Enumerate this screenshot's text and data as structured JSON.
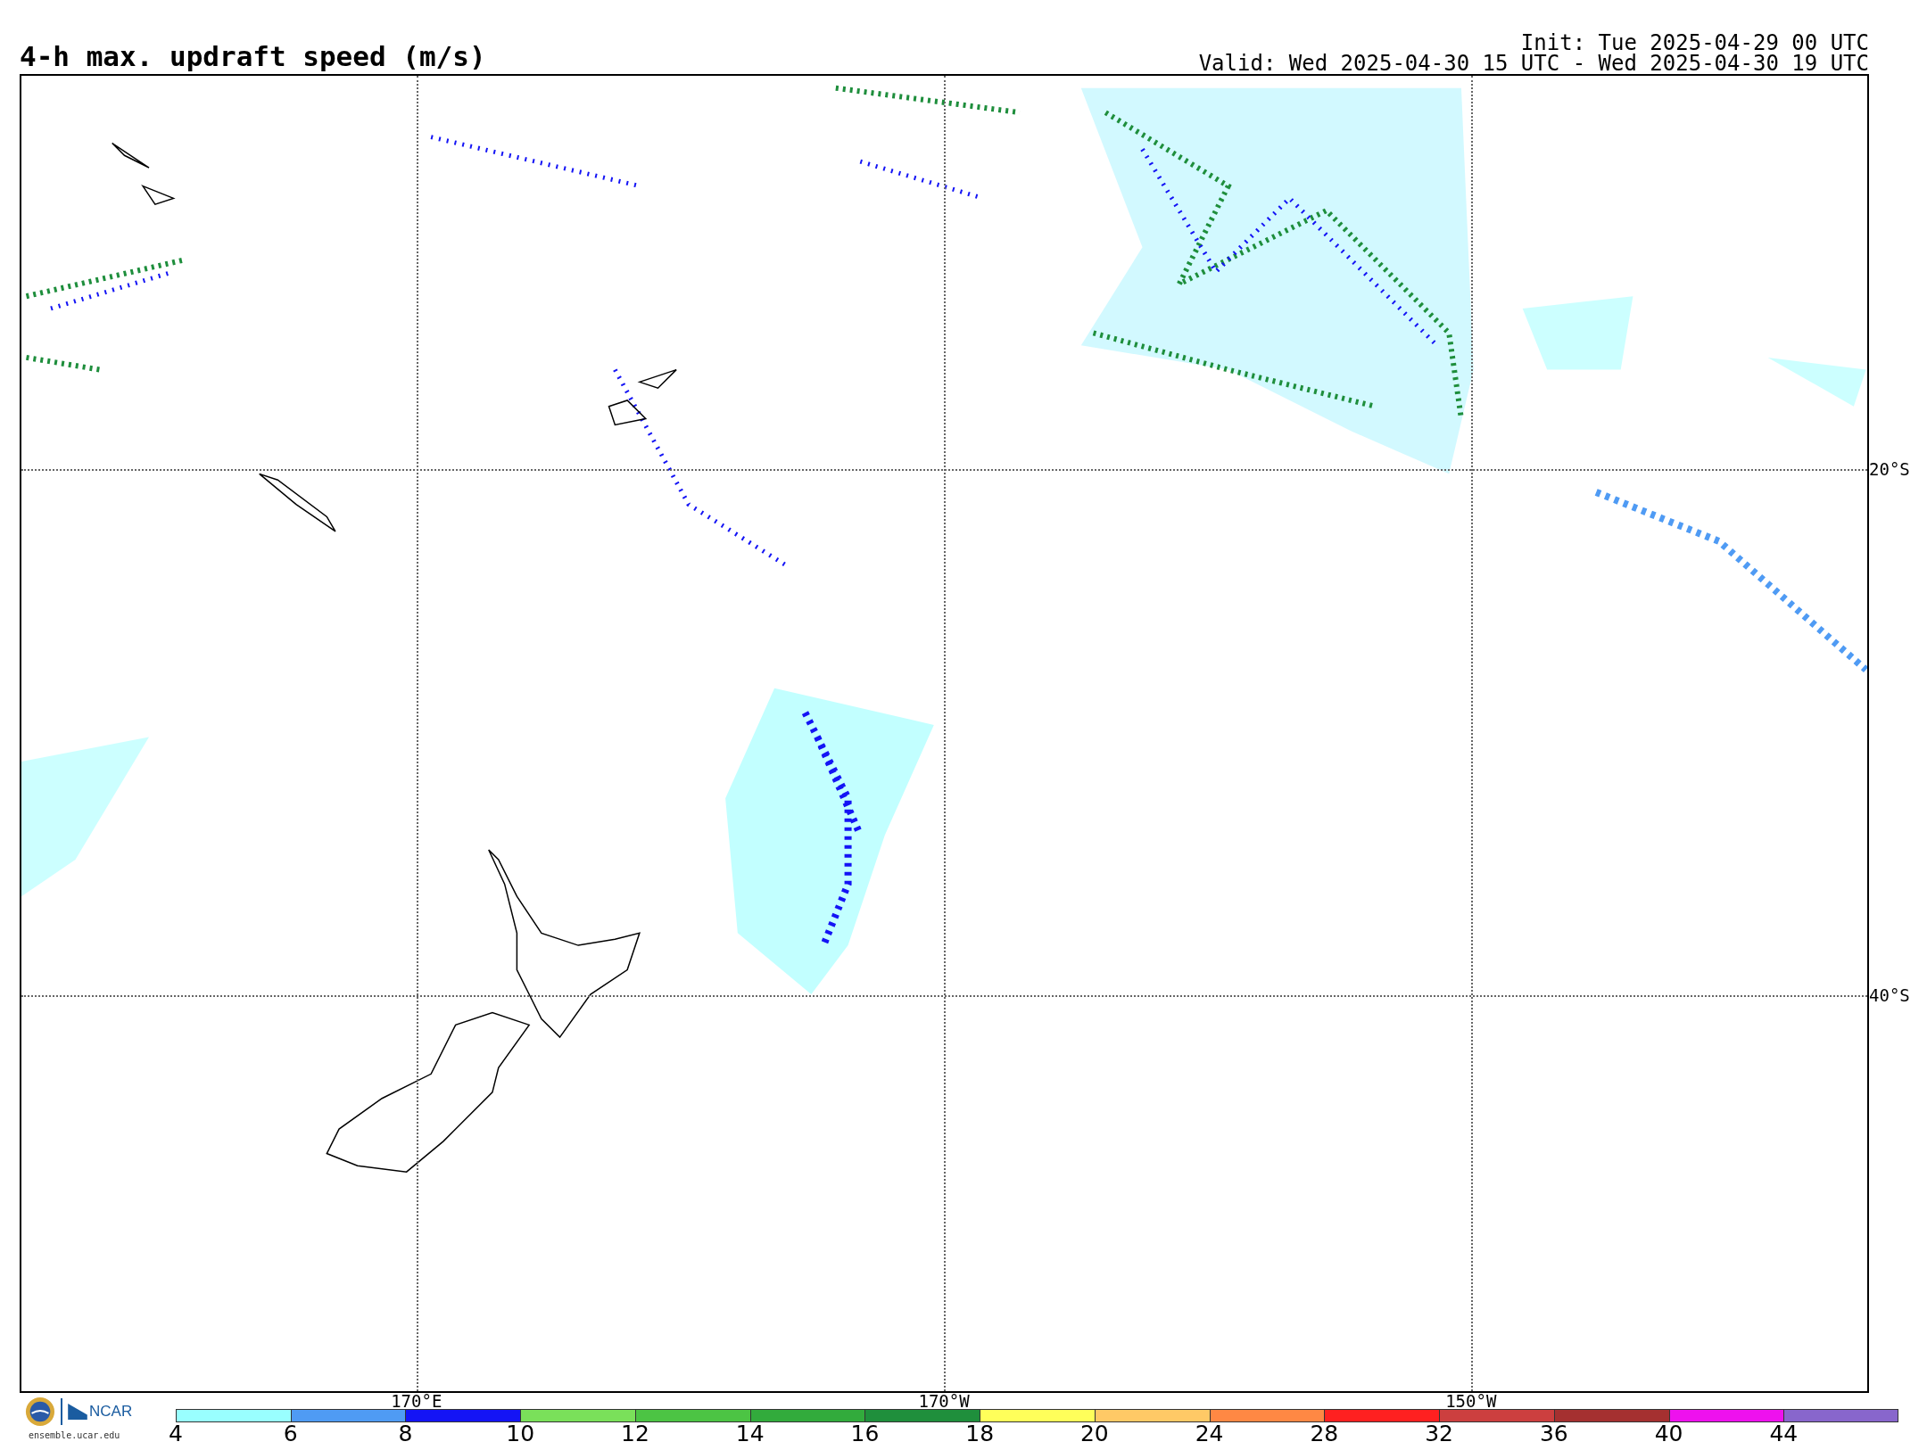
{
  "title": "4-h max. updraft speed (m/s)",
  "init": "Init: Tue 2025-04-29 00 UTC",
  "valid": "Valid: Wed 2025-04-30 15 UTC - Wed 2025-04-30 19 UTC",
  "map": {
    "longitudes": [
      "170°E",
      "170°W",
      "150°W"
    ],
    "latitudes": [
      "20°S",
      "40°S"
    ]
  },
  "logo": {
    "brand": "NCAR",
    "site": "ensemble.ucar.edu"
  },
  "colorbar": [
    {
      "label": "4",
      "color": "#99ffff"
    },
    {
      "label": "6",
      "color": "#4f9bf4"
    },
    {
      "label": "8",
      "color": "#1414f5"
    },
    {
      "label": "10",
      "color": "#7ae05a"
    },
    {
      "label": "12",
      "color": "#4cc444"
    },
    {
      "label": "14",
      "color": "#32ab3c"
    },
    {
      "label": "16",
      "color": "#1f8f3c"
    },
    {
      "label": "18",
      "color": "#ffff5a"
    },
    {
      "label": "20",
      "color": "#ffc966"
    },
    {
      "label": "24",
      "color": "#ff8844"
    },
    {
      "label": "28",
      "color": "#ff2020"
    },
    {
      "label": "32",
      "color": "#cc3f3f"
    },
    {
      "label": "36",
      "color": "#a53030"
    },
    {
      "label": "40",
      "color": "#ee11ee"
    },
    {
      "label": "44",
      "color": "#8866cc"
    }
  ]
}
